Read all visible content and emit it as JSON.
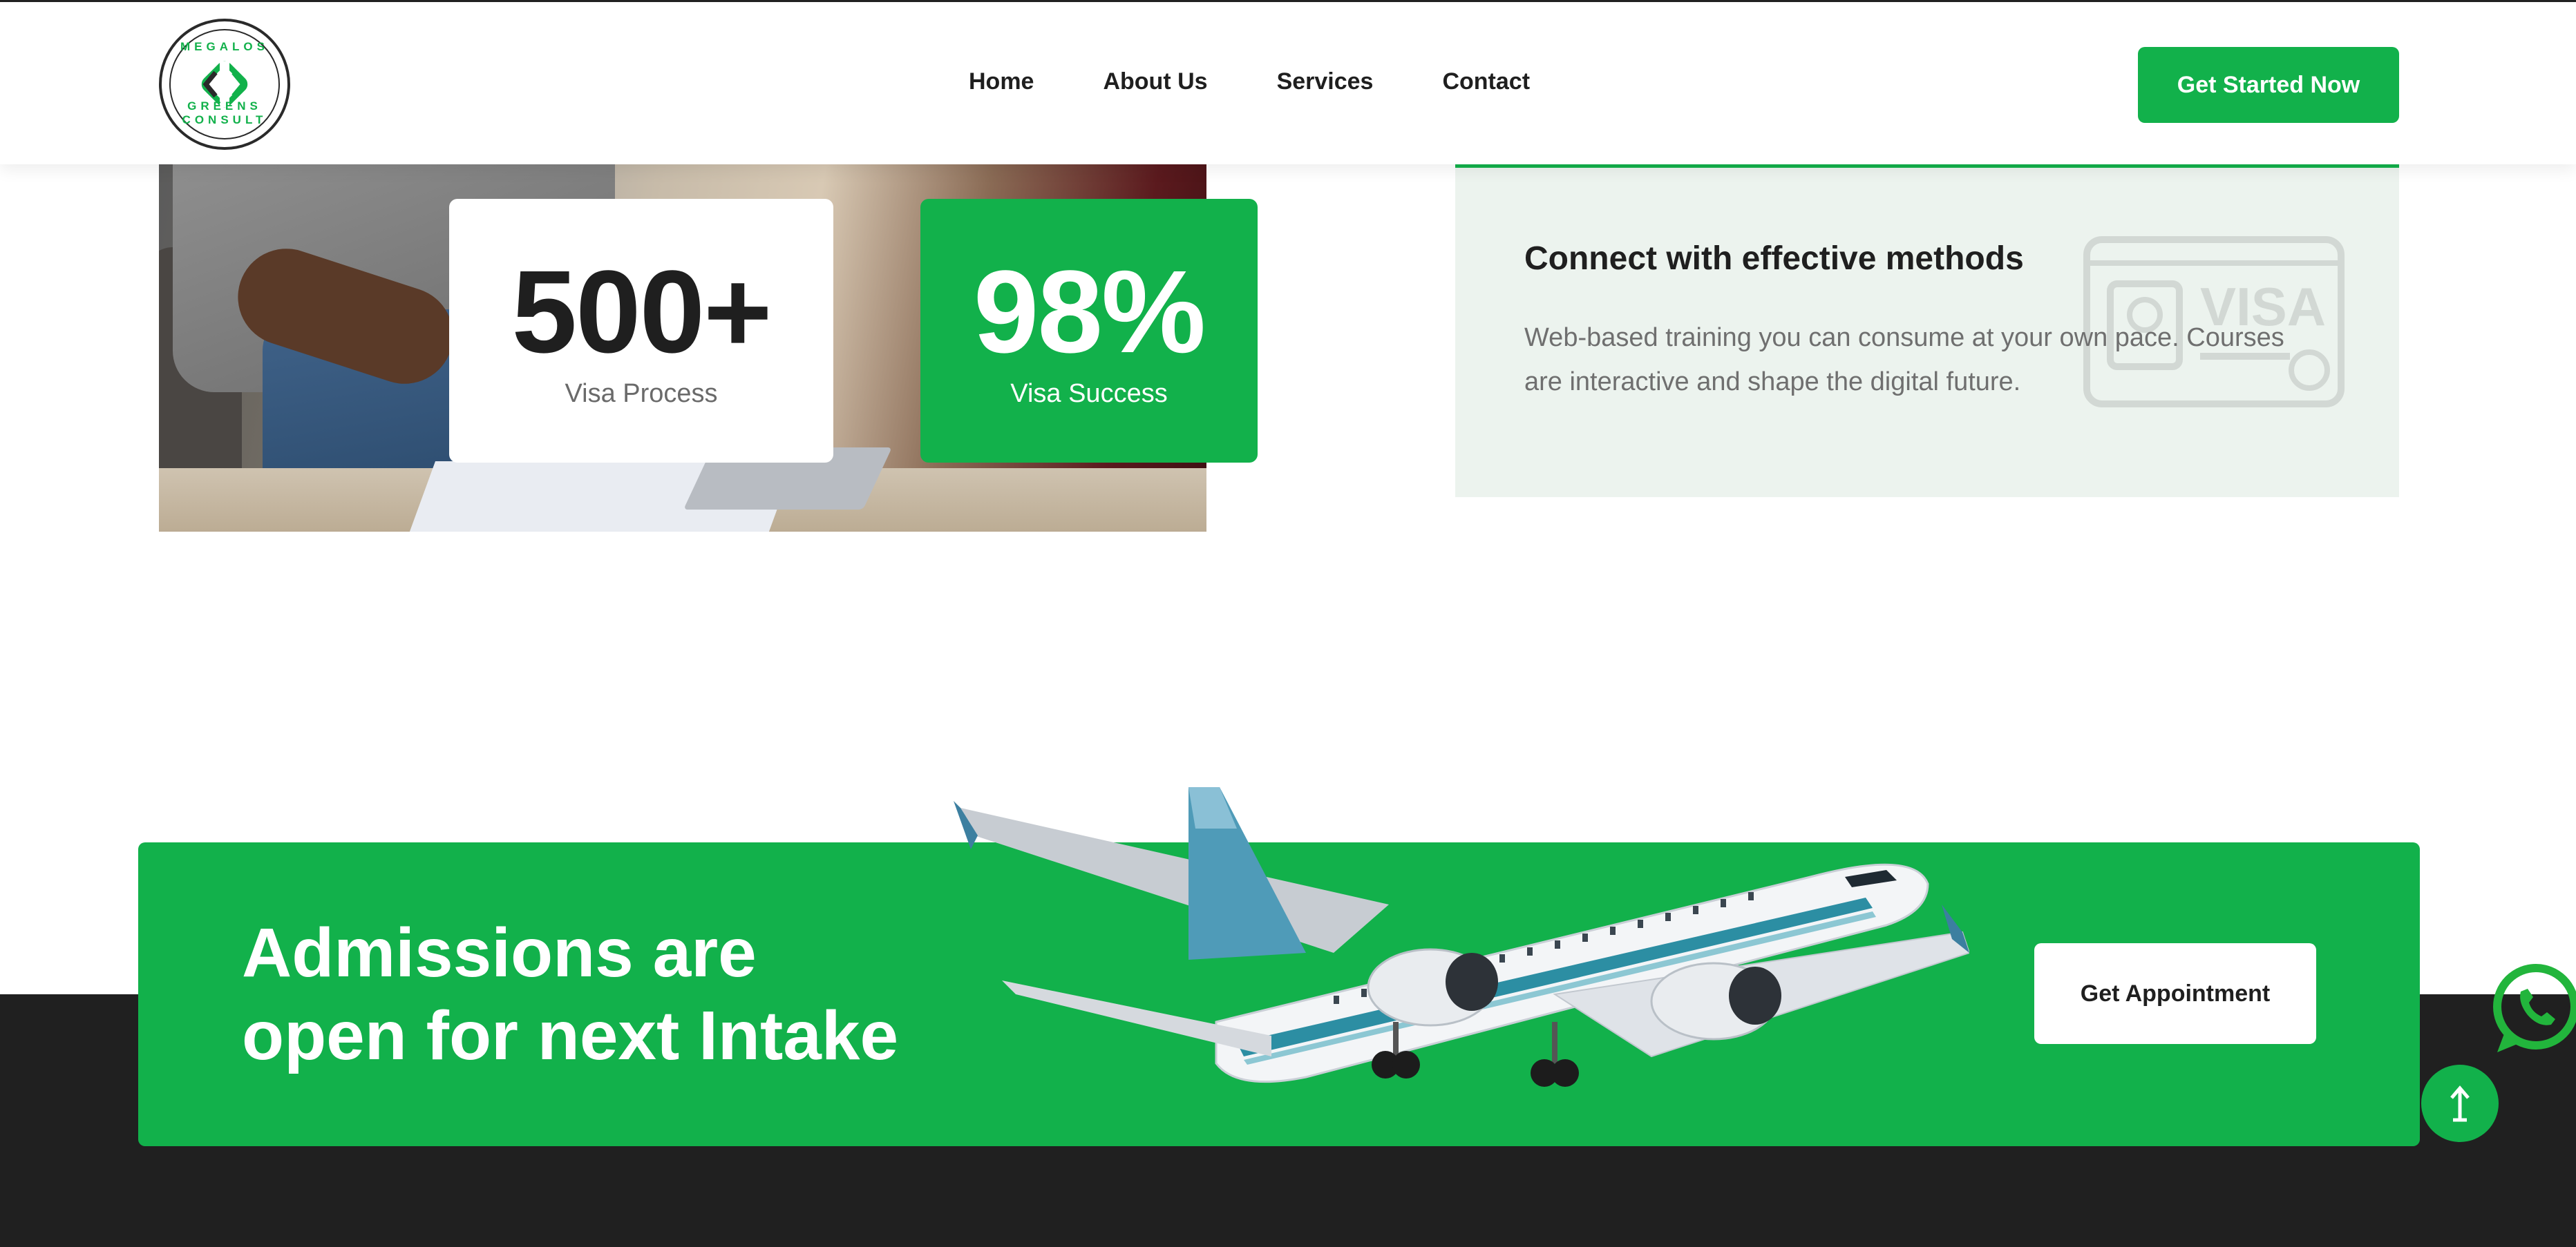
{
  "brand": {
    "logo_text_top": "MEGALOS",
    "logo_text_bottom": "GREENS CONSULT",
    "accent_color": "#12b14b"
  },
  "nav": {
    "items": [
      {
        "label": "Home"
      },
      {
        "label": "About Us"
      },
      {
        "label": "Services"
      },
      {
        "label": "Contact"
      }
    ],
    "cta_label": "Get Started Now"
  },
  "stats": [
    {
      "value": "500+",
      "label": "Visa Process"
    },
    {
      "value": "98%",
      "label": "Visa Success"
    }
  ],
  "feature_card": {
    "title": "Connect with effective methods",
    "text": "Web-based training you can consume at your own pace. Courses are interactive and shape the digital future.",
    "icon": "visa-icon"
  },
  "banner": {
    "heading": "Admissions are open for next Intake",
    "button_label": "Get Appointment"
  },
  "floating": {
    "whatsapp_icon": "whatsapp-icon",
    "scroll_top_icon": "arrow-up-icon"
  }
}
